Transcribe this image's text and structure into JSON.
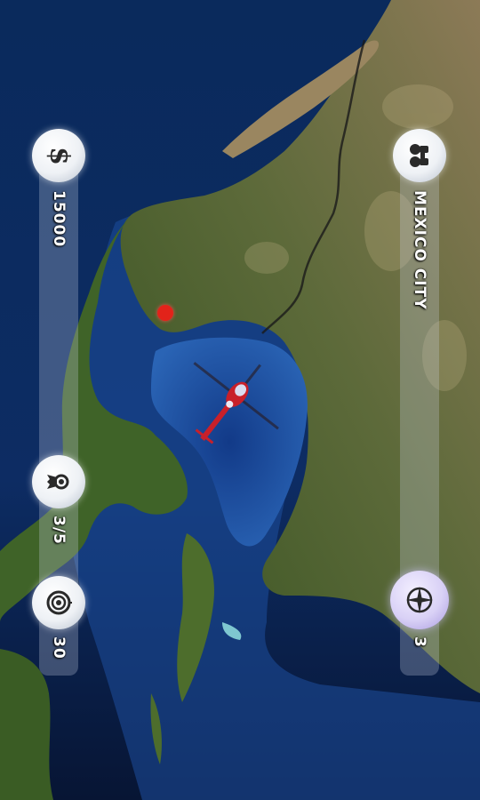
{
  "hud": {
    "money": {
      "value": "15000",
      "icon": "dollar-icon"
    },
    "level": {
      "value": "3/5",
      "icon": "ribbon-icon"
    },
    "fuel": {
      "value": "30",
      "icon": "target-icon"
    },
    "destination": {
      "value": "MEXICO CITY",
      "icon": "binoculars-icon"
    },
    "compass": {
      "value": "3",
      "icon": "compass-icon"
    }
  },
  "colors": {
    "ocean_deep": "#0c2452",
    "ocean_shallow": "#2f6db8",
    "land_green": "#3d5a22",
    "land_desert": "#8a7550",
    "target_pin": "#e2231a",
    "helicopter": "#c8202a"
  }
}
